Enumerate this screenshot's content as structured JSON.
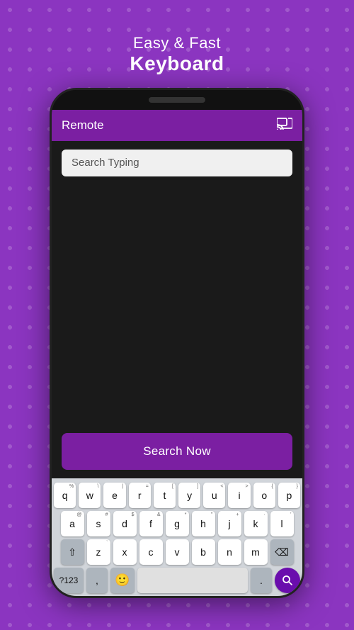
{
  "header": {
    "line1": "Easy & Fast",
    "line2": "Keyboard"
  },
  "appbar": {
    "title": "Remote",
    "cast_label": "cast"
  },
  "screen": {
    "search_placeholder": "Search Typing",
    "search_button": "Search Now"
  },
  "keyboard": {
    "rows": [
      [
        {
          "label": "q",
          "sup": "%"
        },
        {
          "label": "w",
          "sup": "\\"
        },
        {
          "label": "e",
          "sup": "|"
        },
        {
          "label": "r",
          "sup": "="
        },
        {
          "label": "t",
          "sup": "["
        },
        {
          "label": "y",
          "sup": "]"
        },
        {
          "label": "u",
          "sup": "<"
        },
        {
          "label": "i",
          "sup": ">"
        },
        {
          "label": "o",
          "sup": "{"
        },
        {
          "label": "p",
          "sup": "}"
        }
      ],
      [
        {
          "label": "a",
          "sup": "@"
        },
        {
          "label": "s",
          "sup": "#"
        },
        {
          "label": "d",
          "sup": "$"
        },
        {
          "label": "f",
          "sup": "&"
        },
        {
          "label": "g",
          "sup": "*"
        },
        {
          "label": "h",
          "sup": "\""
        },
        {
          "label": "j",
          "sup": "+"
        },
        {
          "label": "k",
          "sup": "·"
        },
        {
          "label": "l",
          "sup": "'"
        }
      ],
      [
        {
          "label": "⇧",
          "type": "shift"
        },
        {
          "label": "z",
          "sup": "`"
        },
        {
          "label": "x"
        },
        {
          "label": "c"
        },
        {
          "label": "v"
        },
        {
          "label": "b"
        },
        {
          "label": "n"
        },
        {
          "label": "m"
        },
        {
          "label": "⌫",
          "type": "delete"
        }
      ]
    ],
    "bottom": {
      "num_label": "?123",
      "comma": ",",
      "emoji": "🙂",
      "period": ".",
      "go_icon": "🔍"
    }
  }
}
